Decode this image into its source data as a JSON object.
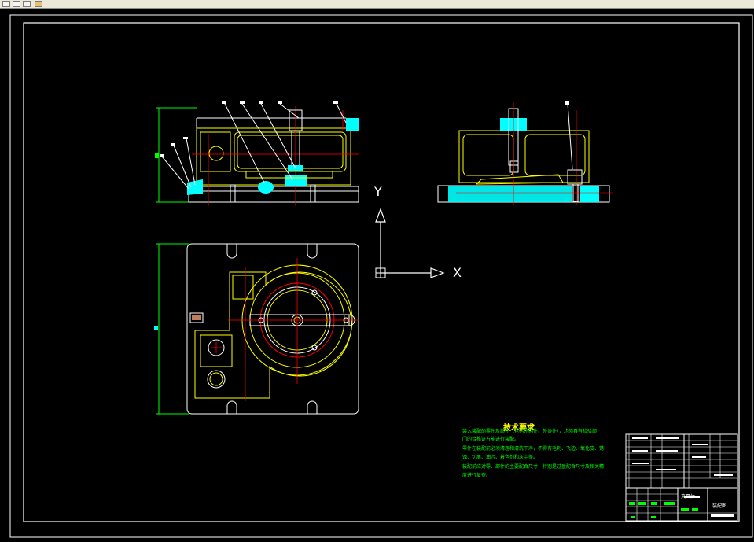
{
  "toolbar": {
    "buttons": [
      "menu-button",
      "draw-button",
      "layer-button",
      "paint-button"
    ]
  },
  "colors": {
    "background": "#000000",
    "frame": "#ffffff",
    "outline": "#ffff00",
    "hatch": "#00ffff",
    "centerline": "#ff0000",
    "dimension": "#00ff00",
    "text_note": "#00ff00",
    "title_text": "#ffff00"
  },
  "ucs": {
    "x_label": "X",
    "y_label": "Y"
  },
  "tech_requirements": {
    "title": "技术要求",
    "lines": [
      "装入装配的零件及部件（包括外购件、外协件），均须具有检验部",
      "门的合格证方能进行装配。",
      "零件在装配前必须清理和清洗干净，不得有毛刺、飞边、氧化皮、锈",
      "蚀、切屑、油污、着色剂和灰尘等。",
      "装配前应对零、部件的主要配合尺寸，特别是过盈配合尺寸及相关精",
      "度进行复查。"
    ]
  },
  "title_block": {
    "drawing_name": "夹具体",
    "sheet_label": "装配图"
  }
}
